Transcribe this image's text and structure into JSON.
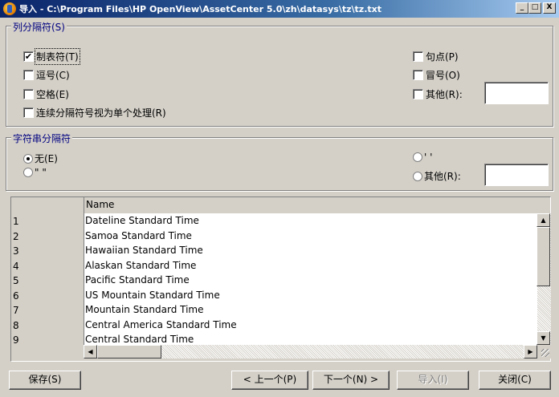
{
  "window": {
    "title": "导入 - C:\\Program Files\\HP OpenView\\AssetCenter 5.0\\zh\\datasys\\tz\\tz.txt",
    "min_glyph": "_",
    "max_glyph": "□",
    "close_glyph": "X"
  },
  "column_separators": {
    "legend": "列分隔符(S)",
    "tab": {
      "label": "制表符(T)",
      "checked": true
    },
    "comma": {
      "label": "逗号(C)",
      "checked": false
    },
    "space": {
      "label": "空格(E)",
      "checked": false
    },
    "consecutive": {
      "label": "连续分隔符号视为单个处理(R)",
      "checked": false
    },
    "period": {
      "label": "句点(P)",
      "checked": false
    },
    "colon": {
      "label": "冒号(O)",
      "checked": false
    },
    "other": {
      "label": "其他(R):",
      "checked": false,
      "value": ""
    }
  },
  "string_separators": {
    "legend": "字符串分隔符",
    "none": {
      "label": "无(E)",
      "selected": true
    },
    "double_quote": {
      "label": "\" \"",
      "selected": false
    },
    "single_quote": {
      "label": "' '",
      "selected": false
    },
    "other": {
      "label": "其他(R):",
      "selected": false,
      "value": ""
    }
  },
  "grid": {
    "column_header": "Name",
    "row_numbers": [
      "1",
      "2",
      "3",
      "4",
      "5",
      "6",
      "7",
      "8",
      "9"
    ],
    "rows": [
      "Dateline Standard Time",
      "Samoa Standard Time",
      "Hawaiian Standard Time",
      "Alaskan Standard Time",
      "Pacific Standard Time",
      "US Mountain Standard Time",
      "Mountain Standard Time",
      "Central America Standard Time",
      "Central Standard Time"
    ]
  },
  "buttons": {
    "save": "保存(S)",
    "prev": "< 上一个(P)",
    "next": "下一个(N) >",
    "import": "导入(I)",
    "close": "关闭(C)"
  }
}
